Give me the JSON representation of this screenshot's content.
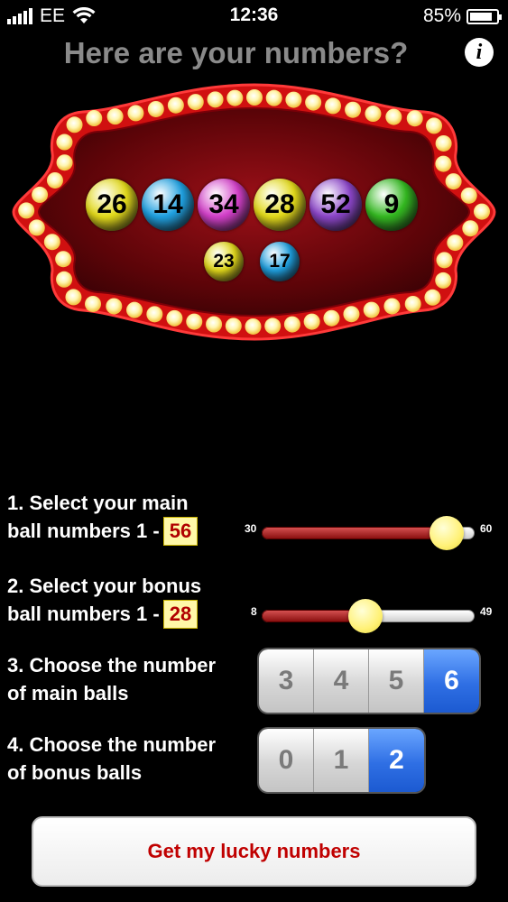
{
  "status": {
    "carrier": "EE",
    "time": "12:36",
    "battery": "85%",
    "battery_level": 0.85
  },
  "header": {
    "title": "Here are your numbers?",
    "info_label": "i"
  },
  "main_balls": [
    {
      "number": "26",
      "color": "#e2d91a"
    },
    {
      "number": "14",
      "color": "#1fa0e0"
    },
    {
      "number": "34",
      "color": "#d23fc8"
    },
    {
      "number": "28",
      "color": "#e2d91a"
    },
    {
      "number": "52",
      "color": "#8b45c8"
    },
    {
      "number": "9",
      "color": "#33b820"
    }
  ],
  "bonus_balls": [
    {
      "number": "23",
      "color": "#e2d91a"
    },
    {
      "number": "17",
      "color": "#1fa0e0"
    }
  ],
  "controls": {
    "main_label_1": "1. Select your main",
    "main_label_2": "ball numbers 1 -",
    "main_value": "56",
    "main_min": "30",
    "main_max": "60",
    "bonus_label_1": "2. Select your bonus",
    "bonus_label_2": "ball numbers 1 -",
    "bonus_value": "28",
    "bonus_min": "8",
    "bonus_max": "49",
    "count_main_label_1": "3. Choose the number",
    "count_main_label_2": "of main balls",
    "count_main_options": [
      "3",
      "4",
      "5",
      "6"
    ],
    "count_main_selected": "6",
    "count_bonus_label_1": "4. Choose the number",
    "count_bonus_label_2": "of bonus balls",
    "count_bonus_options": [
      "0",
      "1",
      "2"
    ],
    "count_bonus_selected": "2"
  },
  "cta": {
    "label": "Get my lucky numbers"
  },
  "colors": {
    "accent_red": "#c00000",
    "thumb_yellow": "#fff176",
    "segment_blue": "#2f6fe4"
  }
}
